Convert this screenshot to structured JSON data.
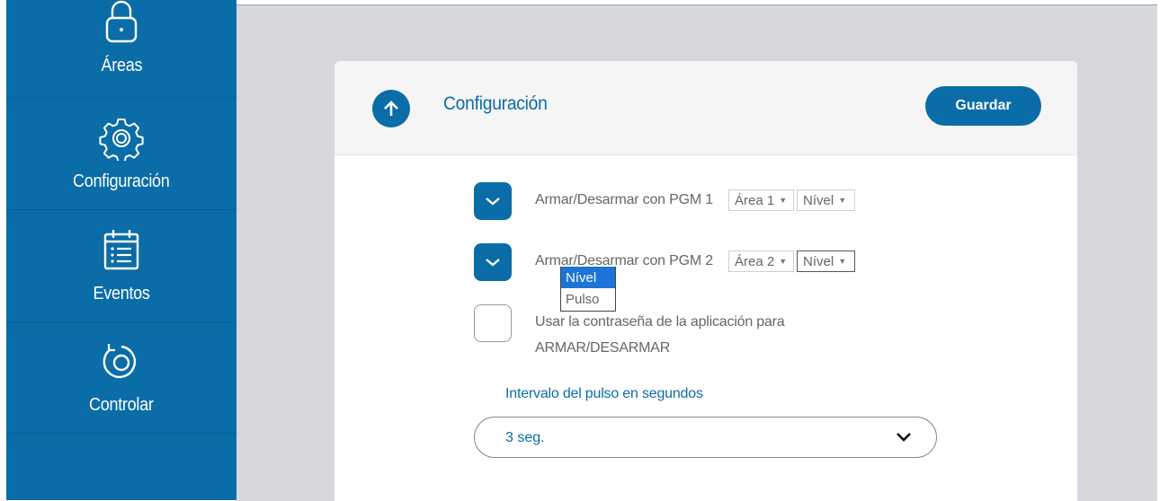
{
  "sidebar": {
    "items": [
      {
        "label": "Áreas",
        "icon": "lock-icon"
      },
      {
        "label": "Configuración",
        "icon": "gear-icon"
      },
      {
        "label": "Eventos",
        "icon": "calendar-list-icon"
      },
      {
        "label": "Controlar",
        "icon": "rotate-icon"
      }
    ]
  },
  "panel": {
    "title": "Configuración",
    "save_label": "Guardar",
    "rows": [
      {
        "checked": true,
        "label": "Armar/Desarmar con PGM 1",
        "area": "Área 1",
        "mode": "Nível"
      },
      {
        "checked": true,
        "label": "Armar/Desarmar con PGM 2",
        "area": "Área 2",
        "mode": "Nível"
      }
    ],
    "dropdown": {
      "options": [
        "Nível",
        "Pulso"
      ],
      "selected": "Nível"
    },
    "password_option": {
      "checked": false,
      "line1": "Usar la contraseña de la aplicación para",
      "line2": "ARMAR/DESARMAR"
    },
    "interval": {
      "label": "Intervalo del pulso en segundos",
      "value": "3 seg."
    }
  },
  "colors": {
    "accent": "#0a6da8",
    "background": "#d7d8dc",
    "dropdown_highlight": "#1e74d6"
  }
}
